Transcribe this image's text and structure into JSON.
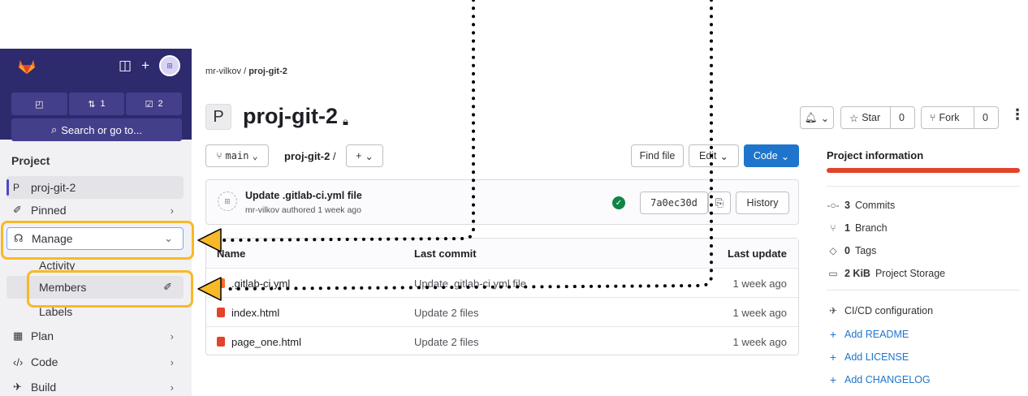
{
  "sidebar": {
    "counters": [
      {
        "icon": "merge-request-icon",
        "count": "1"
      },
      {
        "icon": "todo-icon",
        "count": "2"
      }
    ],
    "search_label": "Search or go to...",
    "section_title": "Project",
    "project_item": {
      "avatar_letter": "P",
      "label": "proj-git-2"
    },
    "pinned_label": "Pinned",
    "manage_label": "Manage",
    "sub_items": {
      "activity": "Activity",
      "members": "Members",
      "labels": "Labels"
    },
    "plan_label": "Plan",
    "code_label": "Code",
    "build_label": "Build"
  },
  "breadcrumb": {
    "owner": "mr-vilkov",
    "separator": "/",
    "project": "proj-git-2"
  },
  "project": {
    "avatar_letter": "P",
    "name": "proj-git-2"
  },
  "header_actions": {
    "star_label": "Star",
    "star_count": "0",
    "fork_label": "Fork",
    "fork_count": "0"
  },
  "toolbar": {
    "branch": "main",
    "path": "proj-git-2",
    "path_sep": "/",
    "add_label": "+",
    "find_file": "Find file",
    "edit": "Edit",
    "code": "Code"
  },
  "last_commit": {
    "title": "Update .gitlab-ci.yml file",
    "meta": "mr-vilkov authored 1 week ago",
    "sha": "7a0ec30d",
    "history": "History",
    "status": "passed"
  },
  "files": {
    "headers": {
      "name": "Name",
      "commit": "Last commit",
      "date": "Last update"
    },
    "rows": [
      {
        "name": ".gitlab-ci.yml",
        "commit": "Update .gitlab-ci.yml file",
        "date": "1 week ago"
      },
      {
        "name": "index.html",
        "commit": "Update 2 files",
        "date": "1 week ago"
      },
      {
        "name": "page_one.html",
        "commit": "Update 2 files",
        "date": "1 week ago"
      }
    ]
  },
  "project_info": {
    "title": "Project information",
    "commits_count": "3",
    "commits_label": "Commits",
    "branch_count": "1",
    "branch_label": "Branch",
    "tags_count": "0",
    "tags_label": "Tags",
    "storage_size": "2 KiB",
    "storage_label": "Project Storage",
    "cicd": "CI/CD configuration",
    "add_readme": "Add README",
    "add_license": "Add LICENSE",
    "add_changelog": "Add CHANGELOG"
  },
  "colors": {
    "brand": "#2d2a6e",
    "accent": "#1f75cb",
    "highlight": "#f7b927",
    "orange": "#e24329",
    "success": "#108548"
  }
}
